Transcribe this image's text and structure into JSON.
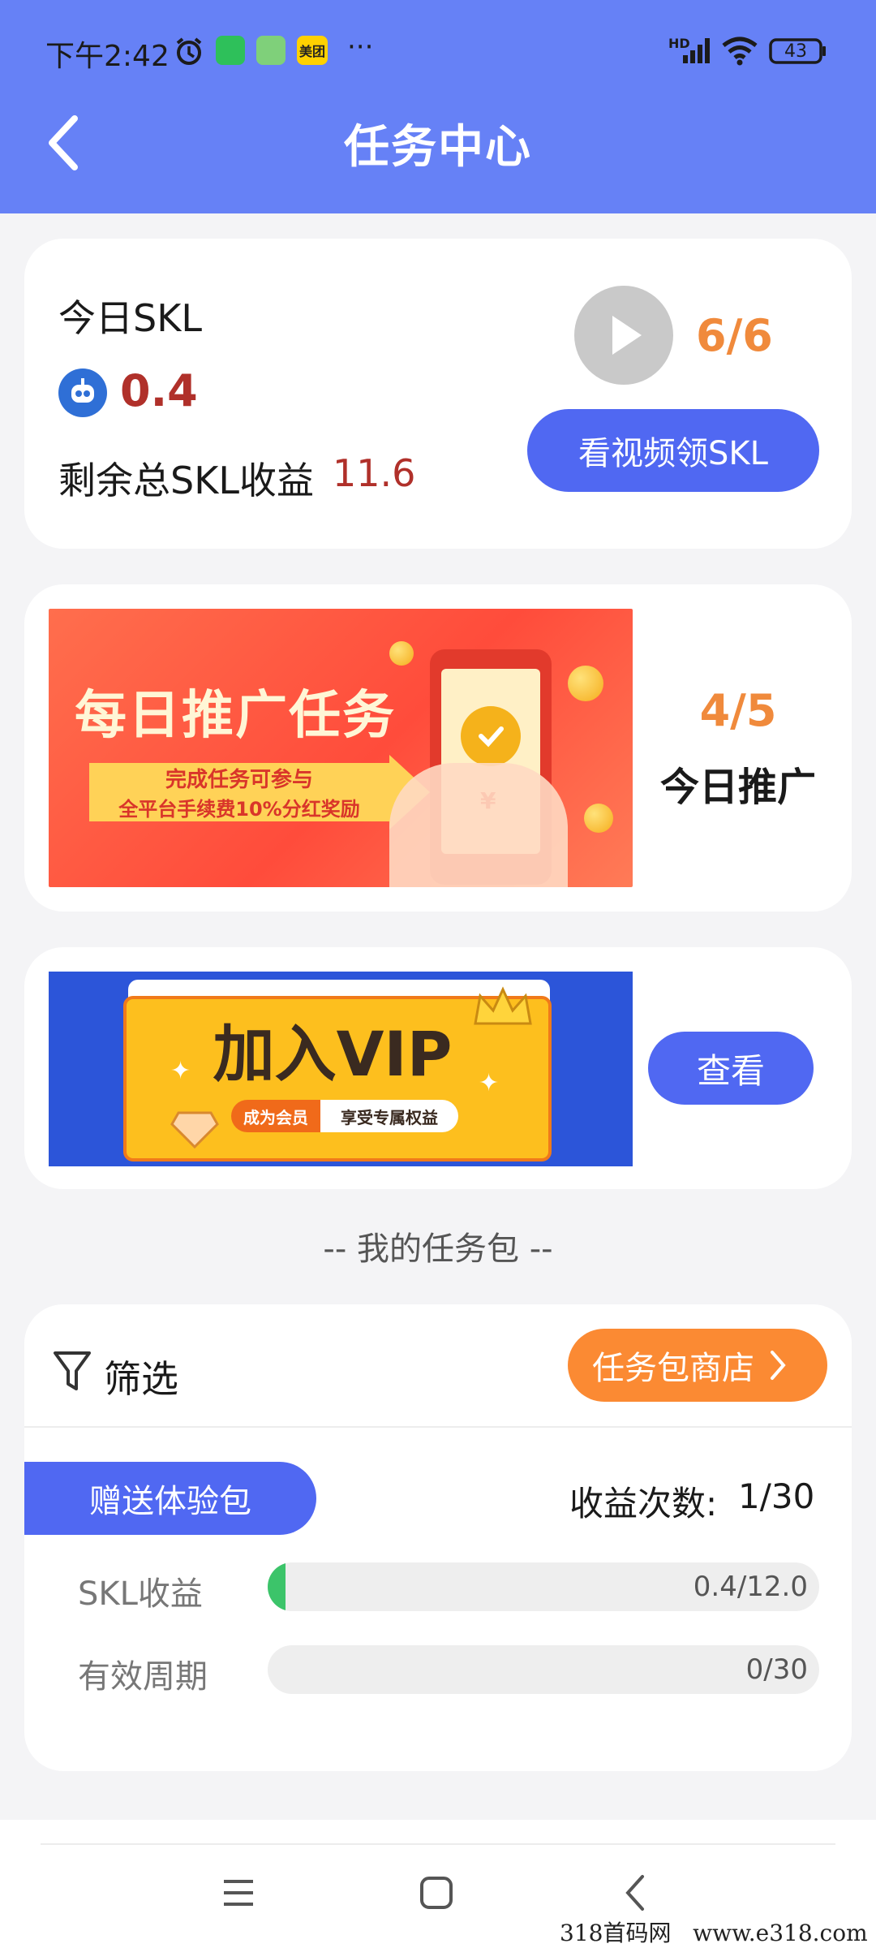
{
  "status_bar": {
    "time": "下午2:42",
    "more": "···",
    "network": "HD",
    "battery": "43",
    "app_badge": "美团"
  },
  "header": {
    "title": "任务中心"
  },
  "skl_card": {
    "label": "今日SKL",
    "today_value": "0.4",
    "remaining_label": "剩余总SKL收益",
    "remaining_value": "11.6",
    "video_count": "6/6",
    "video_button": "看视频领SKL"
  },
  "promo_card": {
    "banner_title": "每日推广任务",
    "banner_line1": "完成任务可参与",
    "banner_line2": "全平台手续费10%分红奖励",
    "count": "4/5",
    "label": "今日推广"
  },
  "vip_card": {
    "banner_title": "加入VIP",
    "badge_left": "成为会员",
    "badge_right": "享受专属权益",
    "button": "查看"
  },
  "section_title": "-- 我的任务包 --",
  "package_card": {
    "filter_label": "筛选",
    "store_button": "任务包商店",
    "package_tag": "赠送体验包",
    "income_count_label": "收益次数:",
    "income_count_value": "1/30",
    "rows": [
      {
        "label": "SKL收益",
        "value": "0.4/12.0",
        "progress": 0.033
      },
      {
        "label": "有效周期",
        "value": "0/30",
        "progress": 0
      }
    ]
  },
  "watermark": "318首码网   www.e318.com",
  "colors": {
    "header_bg": "#6681f6",
    "primary_button": "#5068f2",
    "accent_orange": "#f08a3c",
    "value_red": "#b0302a",
    "progress_green": "#3cc46a"
  }
}
